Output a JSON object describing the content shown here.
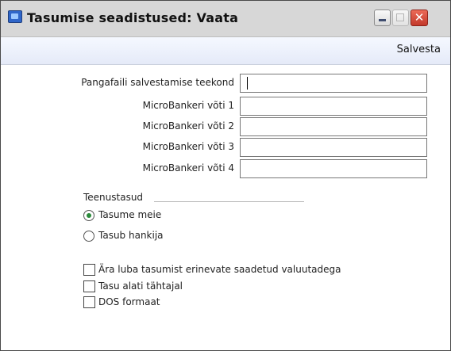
{
  "window": {
    "title": "Tasumise seadistused: Vaata",
    "icon": "app-window-icon",
    "controls": {
      "minimize": "minimize-icon",
      "maximize": "maximize-icon",
      "close": "close-icon",
      "close_glyph": "✕"
    }
  },
  "toolbar": {
    "save_label": "Salvesta"
  },
  "fields": [
    {
      "label": "Pangafaili salvestamise teekond",
      "value": ""
    },
    {
      "label": "MicroBankeri võti 1",
      "value": ""
    },
    {
      "label": "MicroBankeri võti 2",
      "value": ""
    },
    {
      "label": "MicroBankeri võti 3",
      "value": ""
    },
    {
      "label": "MicroBankeri võti 4",
      "value": ""
    }
  ],
  "service_group": {
    "title": "Teenustasud",
    "options": [
      {
        "label": "Tasume meie",
        "selected": true
      },
      {
        "label": "Tasub hankija",
        "selected": false
      }
    ]
  },
  "checkboxes": [
    {
      "label": "Ära luba tasumist erinevate saadetud valuutadega",
      "checked": false
    },
    {
      "label": "Tasu alati tähtajal",
      "checked": false
    },
    {
      "label": "DOS formaat",
      "checked": false
    }
  ],
  "colors": {
    "close_button": "#c2392b",
    "radio_dot": "#2a8a3a",
    "toolbar": "#e5eaf8"
  }
}
